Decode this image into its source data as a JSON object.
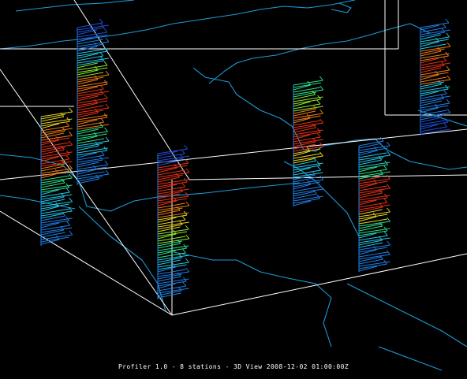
{
  "window": {
    "status_text": "Profiler 1.0 - 8 stations - 3D View 2008-12-02 01:00:00Z"
  },
  "colors": {
    "background": "#000000",
    "bounding_box": "#ffffff",
    "map_lines": "#1e9bd8",
    "wind_scale": [
      "#1d4fd6",
      "#1e7fe8",
      "#22c8e8",
      "#2ce08a",
      "#8ee82c",
      "#e8d21c",
      "#f07a14",
      "#e83016",
      "#d4200c"
    ]
  },
  "icons": {
    "wind_barb": "wind-barb-icon"
  },
  "scene": {
    "view": "3D View",
    "station_count": 8,
    "valid_time": "2008-12-02 01:00:00Z"
  }
}
